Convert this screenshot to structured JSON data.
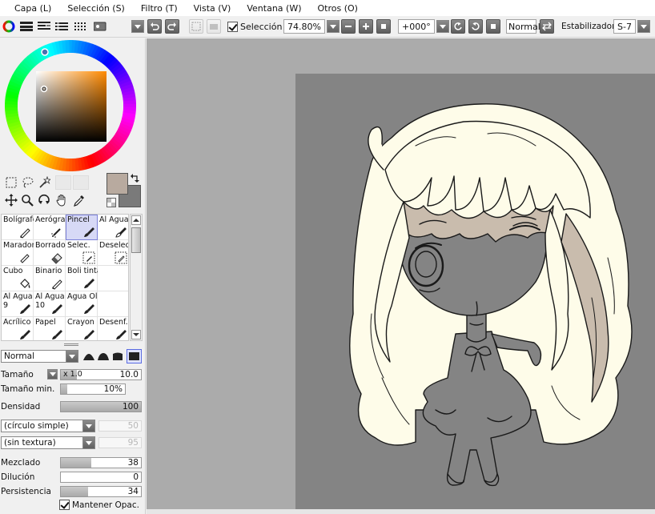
{
  "menu": [
    "Capa (L)",
    "Selección (S)",
    "Filtro (T)",
    "Vista (V)",
    "Ventana (W)",
    "Otros (O)"
  ],
  "toolbar": {
    "selection_label": "Selección",
    "selection_checked": true,
    "zoom": "74.80%",
    "rotation": "+000°",
    "blend_mode": "Normal",
    "stabilizer_label": "Estabilizador",
    "stabilizer_value": "S-7"
  },
  "colors": {
    "primary": "#b8aa9f",
    "secondary": "#7a7a7a",
    "canvas_gray": "#848484",
    "workspace_gray": "#ababab",
    "hair_light": "#fefce9",
    "hair_shadow": "#c9bcad",
    "selected_brush": "#d7d9f6"
  },
  "tools": [
    "rect-select-icon",
    "lasso-icon",
    "magic-wand-icon",
    "move-icon",
    "zoom-icon",
    "rotate-icon",
    "hand-icon",
    "eyedropper-icon"
  ],
  "brushes": [
    {
      "label": "Bolígrafo",
      "glyph": "pen"
    },
    {
      "label": "Aerógrafo",
      "glyph": "airbrush"
    },
    {
      "label": "Pincel",
      "glyph": "brush",
      "selected": true
    },
    {
      "label": "Al Agua",
      "glyph": "watercolor"
    },
    {
      "label": "Marador",
      "glyph": "marker"
    },
    {
      "label": "Borrador",
      "glyph": "eraser"
    },
    {
      "label": "Selec.",
      "glyph": "select-pen"
    },
    {
      "label": "Deselec.",
      "glyph": "deselect-pen"
    },
    {
      "label": "Cubo",
      "glyph": "bucket"
    },
    {
      "label": "Binario",
      "glyph": "pen"
    },
    {
      "label": "Boli tinta",
      "glyph": "brush"
    },
    {
      "label": "",
      "glyph": ""
    },
    {
      "label": "Al Agua\n9",
      "glyph": "brush"
    },
    {
      "label": "Al Agua\n10",
      "glyph": "brush"
    },
    {
      "label": "Agua Ol",
      "glyph": "brush"
    },
    {
      "label": "",
      "glyph": ""
    },
    {
      "label": "Acrílico",
      "glyph": "brush"
    },
    {
      "label": "Papel",
      "glyph": "brush"
    },
    {
      "label": "Crayon",
      "glyph": "brush"
    },
    {
      "label": "Desenf.",
      "glyph": "brush"
    }
  ],
  "settings": {
    "blend": "Normal",
    "size_label": "Tamaño",
    "size_multiplier": "x 1.0",
    "size_value": "10.0",
    "size_fraction": 0.2,
    "min_size_label": "Tamaño min.",
    "min_size_value": "10%",
    "min_size_fraction": 0.1,
    "density_label": "Densidad",
    "density_value": "100",
    "density_fraction": 1.0,
    "shape": "(círculo simple)",
    "shape_value": "50",
    "texture": "(sin textura)",
    "texture_value": "95",
    "mix_label": "Mezclado",
    "mix_value": "38",
    "mix_fraction": 0.38,
    "dilution_label": "Dilución",
    "dilution_value": "0",
    "dilution_fraction": 0.0,
    "persistence_label": "Persistencia",
    "persistence_value": "34",
    "persistence_fraction": 0.34,
    "keep_opacity_label": "Mantener Opac.",
    "keep_opacity_checked": true
  }
}
